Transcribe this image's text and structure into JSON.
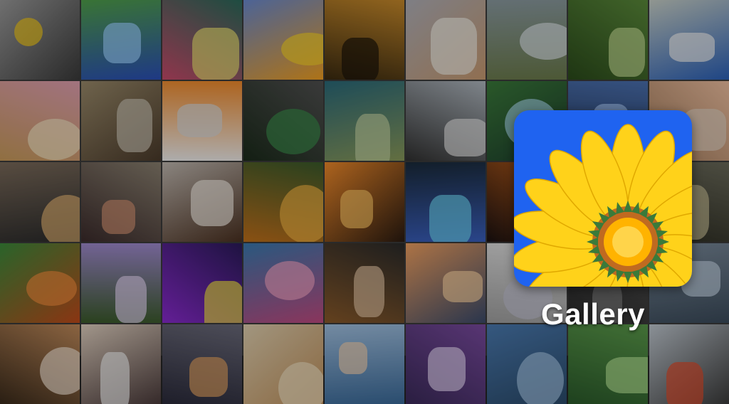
{
  "app": {
    "title": "Gallery",
    "icon": "sunflower-icon",
    "icon_background": "#1f63f0",
    "petal_color": "#ffd21a"
  },
  "tiles": [
    {
      "name": "flowers-on-stones",
      "c1": "#9a9a9a",
      "c2": "#3a3a3a",
      "accent": "#f2c81a"
    },
    {
      "name": "waterfall",
      "c1": "#4fa04a",
      "c2": "#2a4fb8",
      "accent": "#9ad0ff"
    },
    {
      "name": "hands-glowing",
      "c1": "#2a6a5a",
      "c2": "#c84a6a",
      "accent": "#e8e070"
    },
    {
      "name": "parrots",
      "c1": "#6a8ad0",
      "c2": "#f2a020",
      "accent": "#f7d02a"
    },
    {
      "name": "giraffes-sunset",
      "c1": "#c88a2a",
      "c2": "#3a2a10",
      "accent": "#1a1208"
    },
    {
      "name": "wedding-beach",
      "c1": "#b0b0b8",
      "c2": "#c89a70",
      "accent": "#f0ece4"
    },
    {
      "name": "rock-falls",
      "c1": "#8a9aa0",
      "c2": "#6a7a4a",
      "accent": "#d8e0e4"
    },
    {
      "name": "forest-path",
      "c1": "#5a8a3a",
      "c2": "#2a4a1a",
      "accent": "#c0d890"
    },
    {
      "name": "blue-jay",
      "c1": "#c8d0c8",
      "c2": "#2a60b8",
      "accent": "#f0f0f0"
    },
    {
      "name": "puppy-kitten",
      "c1": "#e0a0b0",
      "c2": "#c89a5a",
      "accent": "#f2e2c0"
    },
    {
      "name": "running-shoes",
      "c1": "#9a8a6a",
      "c2": "#4a3a2a",
      "accent": "#c8c0b0"
    },
    {
      "name": "eggs-apricots",
      "c1": "#f08a2a",
      "c2": "#f0f0f0",
      "accent": "#d8d8d8"
    },
    {
      "name": "sports-car",
      "c1": "#505050",
      "c2": "#1a2a1a",
      "accent": "#3a8a4a"
    },
    {
      "name": "sea-turtle",
      "c1": "#2a6a7a",
      "c2": "#8a9a5a",
      "accent": "#c0d0a0"
    },
    {
      "name": "motorcycle",
      "c1": "#b0b8c0",
      "c2": "#303030",
      "accent": "#e0e0e0"
    },
    {
      "name": "jungle-waterfall",
      "c1": "#3a7a3a",
      "c2": "#1a3a2a",
      "accent": "#a0d0e0"
    },
    {
      "name": "eye-blue",
      "c1": "#4a70b0",
      "c2": "#203050",
      "accent": "#a0c0f0"
    },
    {
      "name": "girl-field",
      "c1": "#f0c0a0",
      "c2": "#a07a5a",
      "accent": "#e0d0c0"
    },
    {
      "name": "woman-portrait-1",
      "c1": "#7a6a5a",
      "c2": "#2a2a2a",
      "accent": "#e0b070"
    },
    {
      "name": "woman-portrait-2",
      "c1": "#8a8070",
      "c2": "#3a2a2a",
      "accent": "#d09070"
    },
    {
      "name": "woman-sunglasses",
      "c1": "#c0b8b0",
      "c2": "#4a3020",
      "accent": "#f0e8e0"
    },
    {
      "name": "tigers",
      "c1": "#3a5a2a",
      "c2": "#c0701a",
      "accent": "#f0b040"
    },
    {
      "name": "couple-jump-sunset",
      "c1": "#f08a2a",
      "c2": "#2a1a10",
      "accent": "#f8c060"
    },
    {
      "name": "blue-flower-glass",
      "c1": "#1a2a3a",
      "c2": "#3a60c0",
      "accent": "#6ad0f0"
    },
    {
      "name": "cow-sunset",
      "c1": "#c0601a",
      "c2": "#1a1010",
      "accent": "#f09030"
    },
    {
      "name": "hidden-behind-icon",
      "c1": "#3a3a3a",
      "c2": "#202020",
      "accent": "#606060"
    },
    {
      "name": "wolf",
      "c1": "#6a6a5a",
      "c2": "#2a2a20",
      "accent": "#c0b890"
    },
    {
      "name": "autumn-trees",
      "c1": "#3a8a3a",
      "c2": "#c04a1a",
      "accent": "#f08a3a"
    },
    {
      "name": "wisteria-tunnel",
      "c1": "#a08ad0",
      "c2": "#3a5a2a",
      "accent": "#e0d0f0"
    },
    {
      "name": "purple-flower-butterfly",
      "c1": "#2a1a5a",
      "c2": "#8a2ad0",
      "accent": "#f0e040"
    },
    {
      "name": "underwater-flowers",
      "c1": "#3a7ab0",
      "c2": "#c04a80",
      "accent": "#f0a0c0"
    },
    {
      "name": "horse-running",
      "c1": "#2a2a2a",
      "c2": "#8a5a2a",
      "accent": "#e0c0a0"
    },
    {
      "name": "stones-balance",
      "c1": "#f0a060",
      "c2": "#3a4a6a",
      "accent": "#f8d0a0"
    },
    {
      "name": "hand-pen",
      "c1": "#e0e0e0",
      "c2": "#a0a0a0",
      "accent": "#c0c0d0"
    },
    {
      "name": "hidden-behind-title",
      "c1": "#4a4a4a",
      "c2": "#2a2a2a",
      "accent": "#7a7a7a"
    },
    {
      "name": "rain-window",
      "c1": "#7a8a9a",
      "c2": "#3a4a5a",
      "accent": "#c0d0e0"
    },
    {
      "name": "kids-hats",
      "c1": "#c08a5a",
      "c2": "#3a2a1a",
      "accent": "#f0e0d0"
    },
    {
      "name": "child-cup",
      "c1": "#e0d0c0",
      "c2": "#4a3a3a",
      "accent": "#f0f0f0"
    },
    {
      "name": "mountain-sunset",
      "c1": "#6a6a7a",
      "c2": "#2a2a3a",
      "accent": "#e0a060"
    },
    {
      "name": "woman-reading",
      "c1": "#e0d0b0",
      "c2": "#c0905a",
      "accent": "#f0e0c0"
    },
    {
      "name": "hands-sky",
      "c1": "#a0c0e0",
      "c2": "#3a6a9a",
      "accent": "#f0d0b0"
    },
    {
      "name": "birds-purple-sky",
      "c1": "#7a4aa0",
      "c2": "#3a2a5a",
      "accent": "#e0d0f0"
    },
    {
      "name": "blue-landscape",
      "c1": "#4a7ab0",
      "c2": "#2a4a6a",
      "accent": "#a0c0e0"
    },
    {
      "name": "green-meadow",
      "c1": "#5a9a4a",
      "c2": "#2a5a2a",
      "accent": "#b0e090"
    },
    {
      "name": "runner",
      "c1": "#c0c8d0",
      "c2": "#3a3a3a",
      "accent": "#e04a2a"
    }
  ]
}
